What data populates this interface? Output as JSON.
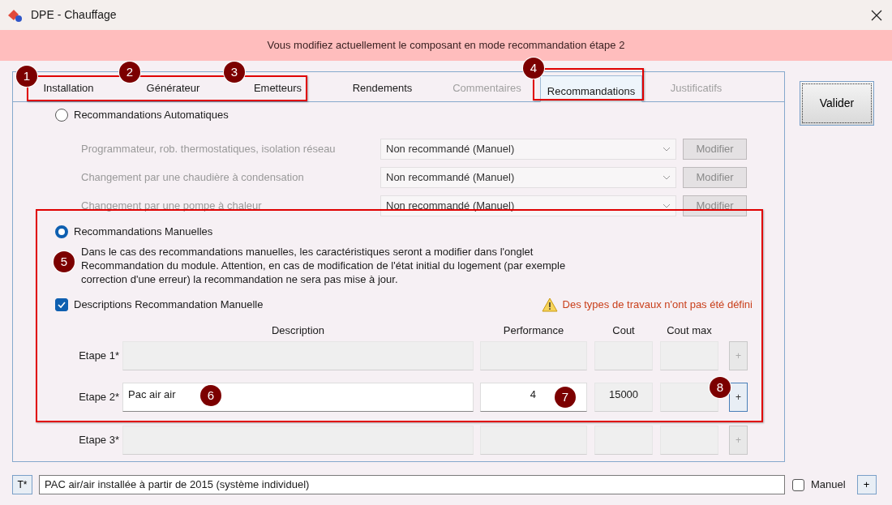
{
  "window": {
    "title": "DPE - Chauffage"
  },
  "banner": "Vous modifiez actuellement le composant en mode recommandation étape 2",
  "tabs": [
    {
      "label": "Installation",
      "selected": false,
      "disabled": false
    },
    {
      "label": "Générateur",
      "selected": false,
      "disabled": false
    },
    {
      "label": "Emetteurs",
      "selected": false,
      "disabled": false
    },
    {
      "label": "Rendements",
      "selected": false,
      "disabled": false
    },
    {
      "label": "Commentaires",
      "selected": false,
      "disabled": true
    },
    {
      "label": "Recommandations",
      "selected": true,
      "disabled": false
    },
    {
      "label": "Justificatifs",
      "selected": false,
      "disabled": true
    }
  ],
  "validate_button": "Valider",
  "automatic": {
    "label": "Recommandations Automatiques",
    "selected": false,
    "rows": [
      {
        "label": "Programmateur, rob. thermostatiques, isolation réseau",
        "value": "Non recommandé (Manuel)",
        "button": "Modifier"
      },
      {
        "label": "Changement par une chaudière à condensation",
        "value": "Non recommandé (Manuel)",
        "button": "Modifier"
      },
      {
        "label": "Changement par une pompe à chaleur",
        "value": "Non recommandé (Manuel)",
        "button": "Modifier"
      }
    ]
  },
  "manual": {
    "label": "Recommandations Manuelles",
    "selected": true,
    "note": "Dans le cas des recommandations manuelles, les caractéristiques seront a modifier dans l'onglet Recommandation du module. Attention, en cas de modification de l'état initial du logement (par exemple correction d'une erreur) la recommandation ne sera pas mise à jour.",
    "checkbox": {
      "label": "Descriptions Recommandation Manuelle",
      "checked": true
    },
    "warning": "Des types de travaux n'ont pas été défini",
    "columns": [
      "Description",
      "Performance",
      "Cout",
      "Cout max"
    ],
    "rows": [
      {
        "label": "Etape 1*",
        "disabled": true,
        "button": "+"
      },
      {
        "label": "Etape 2*",
        "disabled": false,
        "description": "Pac air air",
        "performance": "4",
        "cout": "15000",
        "button": "+"
      },
      {
        "label": "Etape 3*",
        "disabled": true,
        "button": "+"
      }
    ]
  },
  "footer": {
    "type_button": "T*",
    "value": "PAC air/air installée à partir de 2015 (système individuel)",
    "manual_checkbox": {
      "label": "Manuel",
      "checked": false
    },
    "add_button": "+"
  },
  "annotations": [
    "1",
    "2",
    "3",
    "4",
    "5",
    "6",
    "7",
    "8"
  ]
}
